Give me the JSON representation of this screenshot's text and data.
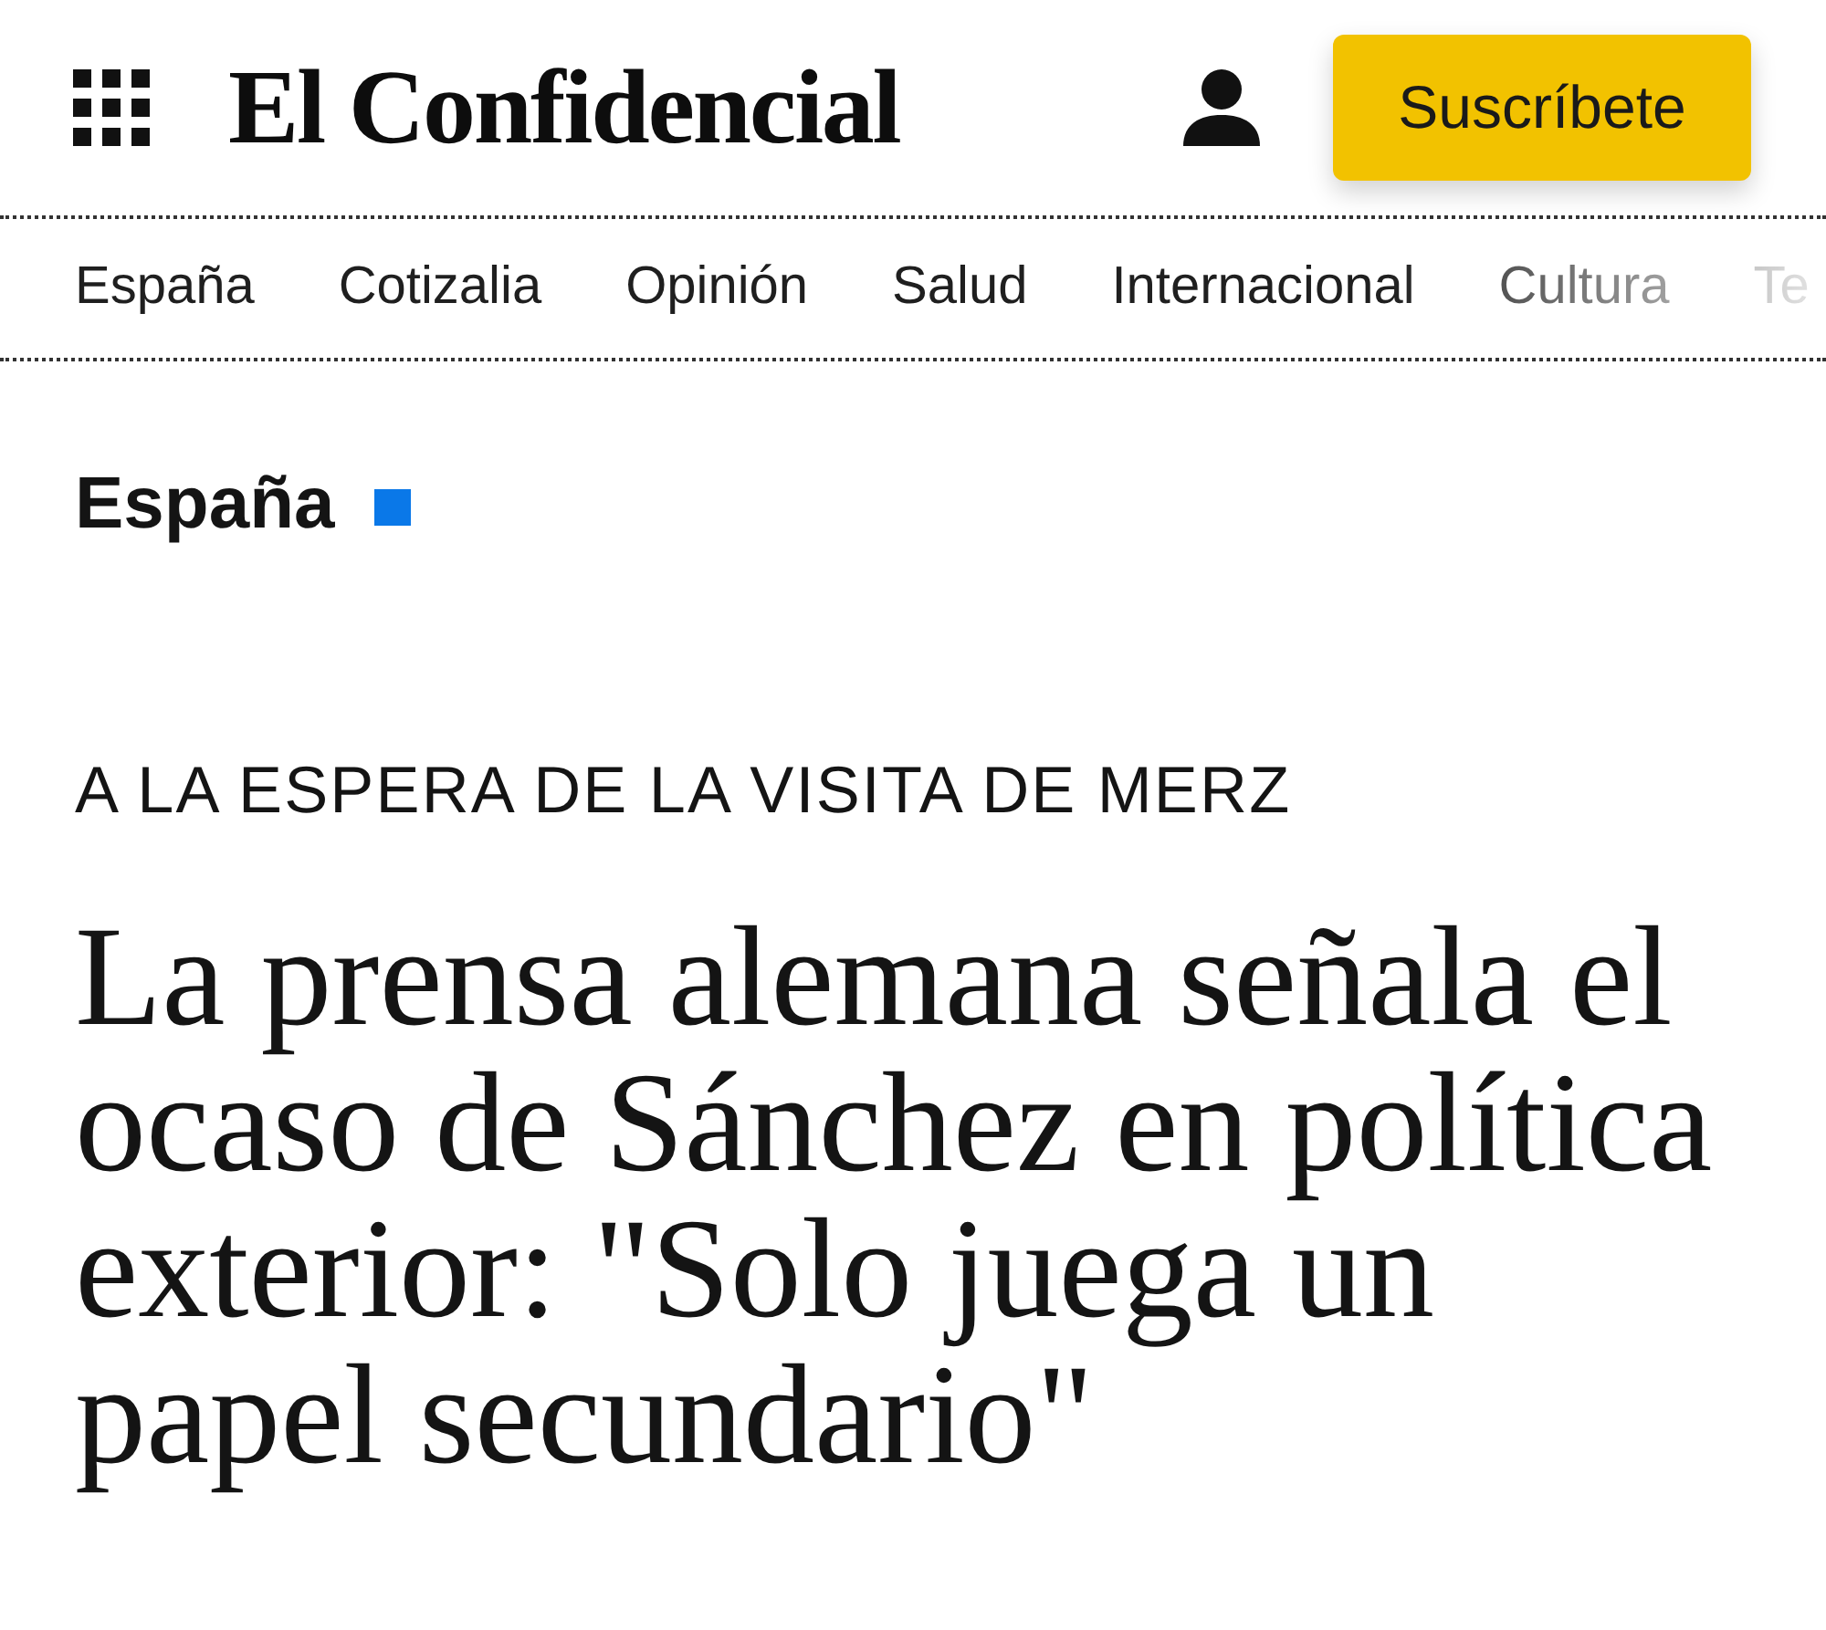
{
  "header": {
    "logo": "El Confidencial",
    "subscribe_button": "Suscríbete"
  },
  "nav": {
    "items": [
      "España",
      "Cotizalia",
      "Opinión",
      "Salud",
      "Internacional",
      "Cultura",
      "Te"
    ]
  },
  "section": {
    "title": "España"
  },
  "article": {
    "kicker": "A LA ESPERA DE LA VISITA DE MERZ",
    "headline": "La prensa alemana señala el ocaso de Sánchez en política exterior: \"Solo juega un papel secundario\""
  }
}
